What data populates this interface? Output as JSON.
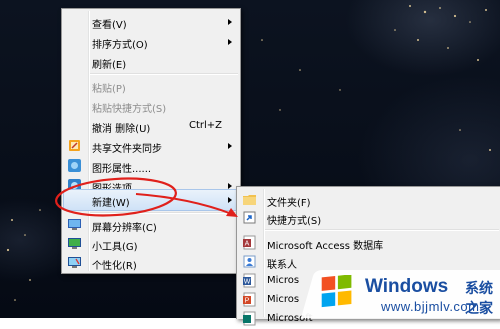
{
  "context_menu": {
    "items": [
      {
        "label": "查看(V)",
        "has_submenu": true
      },
      {
        "label": "排序方式(O)",
        "has_submenu": true
      },
      {
        "label": "刷新(E)"
      },
      {
        "label": "粘贴(P)",
        "disabled": true
      },
      {
        "label": "粘贴快捷方式(S)",
        "disabled": true
      },
      {
        "label": "撤消 删除(U)",
        "shortcut": "Ctrl+Z"
      },
      {
        "label": "共享文件夹同步",
        "has_submenu": true,
        "icon": "sync-share-icon"
      },
      {
        "label": "图形属性......",
        "icon": "graphics-properties-icon"
      },
      {
        "label": "图形选项",
        "has_submenu": true,
        "icon": "graphics-options-icon"
      },
      {
        "label": "新建(W)",
        "has_submenu": true,
        "highlighted": true
      },
      {
        "label": "屏幕分辨率(C)",
        "icon": "screen-resolution-icon"
      },
      {
        "label": "小工具(G)",
        "icon": "gadgets-icon"
      },
      {
        "label": "个性化(R)",
        "icon": "personalize-icon"
      }
    ]
  },
  "new_submenu": {
    "items": [
      {
        "label": "文件夹(F)",
        "icon": "folder-icon"
      },
      {
        "label": "快捷方式(S)",
        "icon": "shortcut-icon"
      },
      {
        "label": "Microsoft Access 数据库",
        "icon": "access-icon"
      },
      {
        "label": "联系人",
        "icon": "contact-icon"
      },
      {
        "label": "Micros",
        "icon": "word-icon"
      },
      {
        "label": "Micros",
        "icon": "powerpoint-icon"
      },
      {
        "label": "Microsoft",
        "icon": "publisher-icon"
      }
    ]
  },
  "watermark": {
    "brand": "Windows",
    "brand_cn": "系统之家",
    "url": "www.bjjmlv.com"
  },
  "colors": {
    "menu_bg": "#f0f0f0",
    "highlight": "#cfe2f7",
    "annotation_red": "#e0201b",
    "logo_blue": "#1a4ea1"
  }
}
